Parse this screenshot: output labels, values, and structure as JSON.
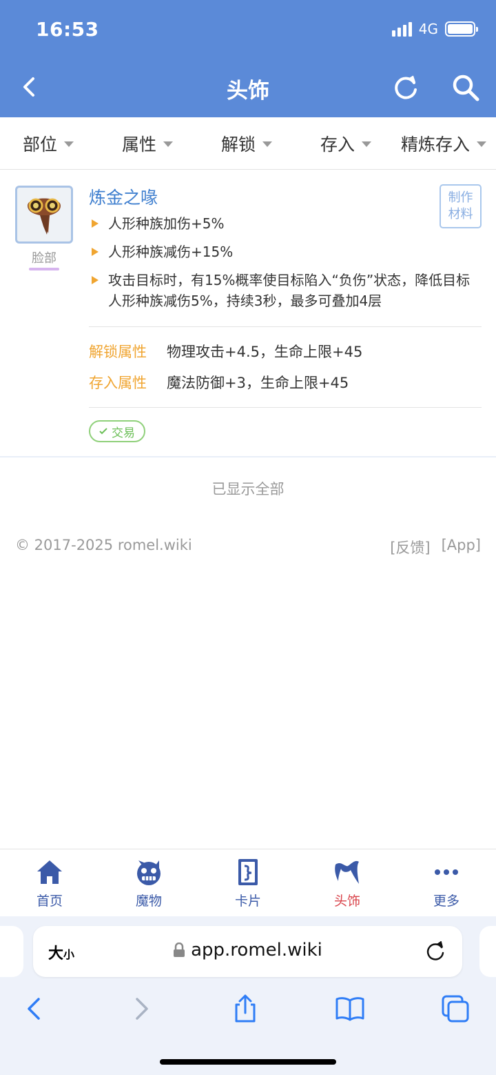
{
  "status": {
    "time": "16:53",
    "network": "4G"
  },
  "header": {
    "title": "头饰"
  },
  "filters": [
    {
      "label": "部位"
    },
    {
      "label": "属性"
    },
    {
      "label": "解锁"
    },
    {
      "label": "存入"
    },
    {
      "label": "精炼存入"
    }
  ],
  "item": {
    "name": "炼金之喙",
    "slot": "脸部",
    "badge": [
      "制作",
      "材料"
    ],
    "effects": [
      "人形种族加伤+5%",
      "人形种族减伤+15%",
      "攻击目标时，有15%概率使目标陷入“负伤”状态，降低目标人形种族减伤5%，持续3秒，最多可叠加4层"
    ],
    "unlock_label": "解锁属性",
    "unlock_value": "物理攻击+4.5，生命上限+45",
    "deposit_label": "存入属性",
    "deposit_value": "魔法防御+3，生命上限+45",
    "trade_tag": "交易"
  },
  "list_end": "已显示全部",
  "footer": {
    "copyright": "© 2017-2025 romel.wiki",
    "feedback": "[反馈]",
    "app": "[App]"
  },
  "tabbar": [
    {
      "label": "首页",
      "icon": "home-icon"
    },
    {
      "label": "魔物",
      "icon": "monster-icon"
    },
    {
      "label": "卡片",
      "icon": "card-icon"
    },
    {
      "label": "头饰",
      "icon": "headwear-icon",
      "active": true
    },
    {
      "label": "更多",
      "icon": "more-icon"
    }
  ],
  "browser": {
    "text_size": "大",
    "text_size_small": "小",
    "url": "app.romel.wiki"
  },
  "colors": {
    "header": "#5b8ad8",
    "accent_blue": "#3f7fcf",
    "accent_orange": "#f0a531",
    "active_tab": "#d9434a",
    "trade_green": "#6bbf57"
  }
}
